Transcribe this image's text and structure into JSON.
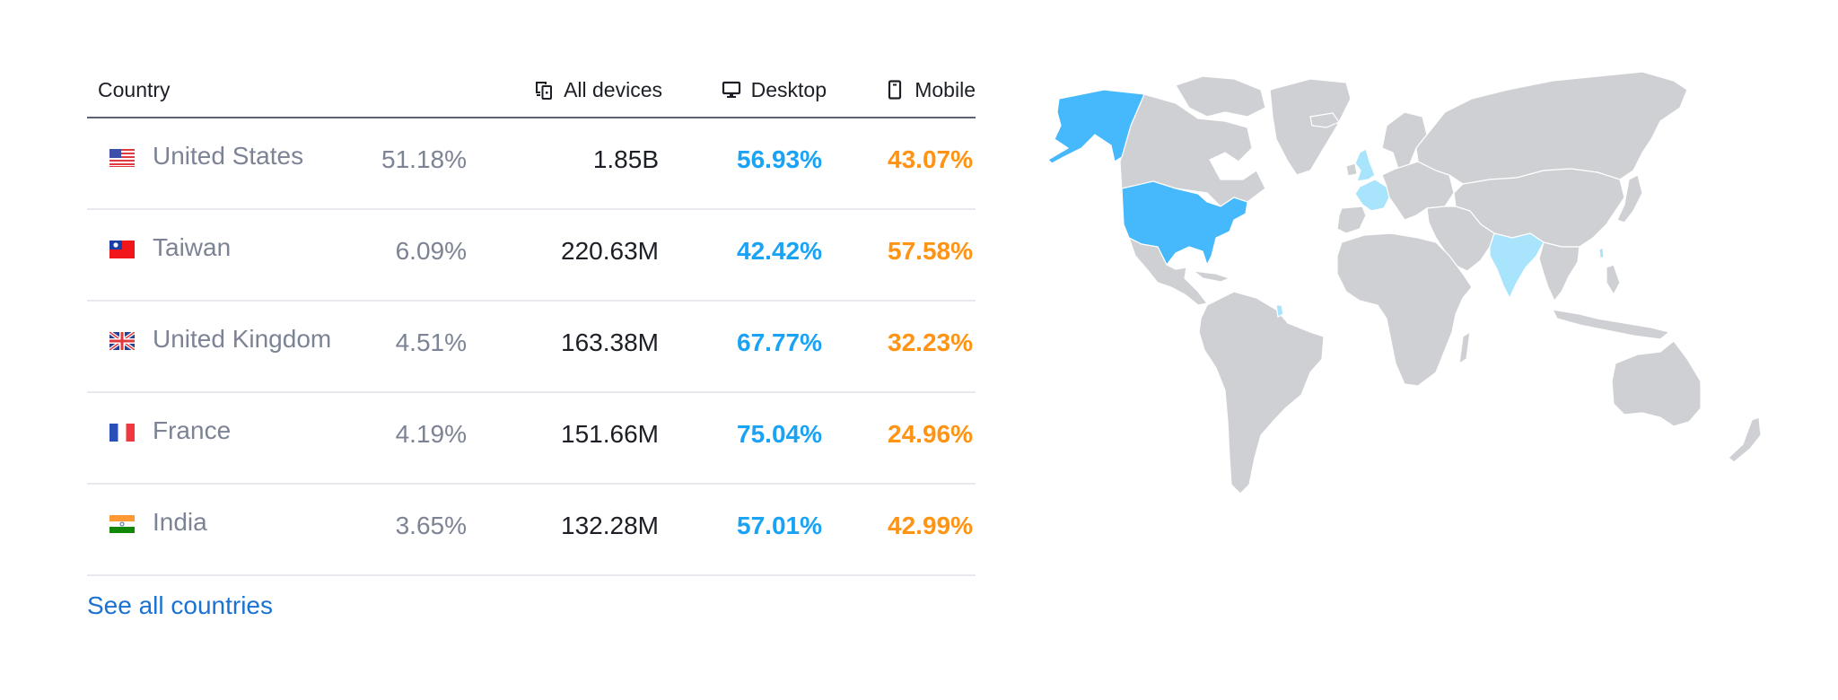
{
  "table": {
    "headers": {
      "country": "Country",
      "all_devices": "All devices",
      "desktop": "Desktop",
      "mobile": "Mobile"
    },
    "header_icons": {
      "all_devices": "devices-icon",
      "desktop": "desktop-monitor-icon",
      "mobile": "mobile-phone-icon"
    },
    "rows": [
      {
        "country": "United States",
        "flag": "us-flag-icon",
        "share": "51.18%",
        "visits": "1.85B",
        "desktop": "56.93%",
        "mobile": "43.07%"
      },
      {
        "country": "Taiwan",
        "flag": "taiwan-flag-icon",
        "share": "6.09%",
        "visits": "220.63M",
        "desktop": "42.42%",
        "mobile": "57.58%"
      },
      {
        "country": "United Kingdom",
        "flag": "uk-flag-icon",
        "share": "4.51%",
        "visits": "163.38M",
        "desktop": "67.77%",
        "mobile": "32.23%"
      },
      {
        "country": "France",
        "flag": "france-flag-icon",
        "share": "4.19%",
        "visits": "151.66M",
        "desktop": "75.04%",
        "mobile": "24.96%"
      },
      {
        "country": "India",
        "flag": "india-flag-icon",
        "share": "3.65%",
        "visits": "132.28M",
        "desktop": "57.01%",
        "mobile": "42.99%"
      }
    ]
  },
  "see_all_link": "See all countries",
  "map": {
    "highlighted_strong": [
      "United States"
    ],
    "highlighted_light": [
      "United Kingdom",
      "France",
      "India",
      "Taiwan",
      "French Guiana"
    ],
    "colors": {
      "land": "#cfd0d4",
      "strong": "#45b9fc",
      "light": "#a8e4fb"
    }
  },
  "colors": {
    "desktop_value": "#1aa3f5",
    "mobile_value": "#ff9314",
    "link": "#1a72d1",
    "muted_text": "#7c8394",
    "primary_text": "#1d1f26"
  }
}
